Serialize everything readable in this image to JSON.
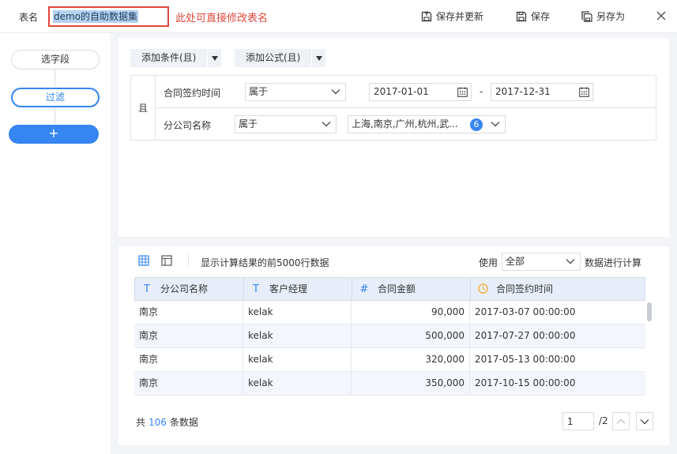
{
  "header": {
    "table_name_label": "表名",
    "table_name_value": "demo的自助数据集",
    "rename_hint": "此处可直接修改表名",
    "save_update_label": "保存并更新",
    "save_label": "保存",
    "save_as_label": "另存为"
  },
  "sidebar": {
    "steps": [
      {
        "label": "选字段"
      },
      {
        "label": "过滤"
      }
    ],
    "add_label": "+"
  },
  "filter": {
    "add_condition_label": "添加条件(且)",
    "add_formula_label": "添加公式(且)",
    "logic_label": "且",
    "rows": [
      {
        "field": "合同签约时间",
        "operator": "属于",
        "start_date": "2017-01-01",
        "separator": "-",
        "end_date": "2017-12-31"
      },
      {
        "field": "分公司名称",
        "operator": "属于",
        "values": "上海,南京,广州,杭州,武...",
        "count": "6"
      }
    ]
  },
  "result": {
    "hint": "显示计算结果的前5000行数据",
    "use_label": "使用",
    "use_value": "全部",
    "calc_label": "数据进行计算",
    "columns": [
      {
        "icon": "T",
        "label": "分公司名称"
      },
      {
        "icon": "T",
        "label": "客户经理"
      },
      {
        "icon": "#",
        "label": "合同金额"
      },
      {
        "icon": "clock",
        "label": "合同签约时间"
      }
    ],
    "rows": [
      [
        "南京",
        "kelak",
        "90,000",
        "2017-03-07 00:00:00"
      ],
      [
        "南京",
        "kelak",
        "500,000",
        "2017-07-27 00:00:00"
      ],
      [
        "南京",
        "kelak",
        "320,000",
        "2017-05-13 00:00:00"
      ],
      [
        "南京",
        "kelak",
        "350,000",
        "2017-10-15 00:00:00"
      ]
    ],
    "total_prefix": "共",
    "total_count": "106",
    "total_suffix": "条数据",
    "page_current": "1",
    "page_total": "/2"
  },
  "colors": {
    "accent": "#3685f2",
    "warning": "#e0463a",
    "clock": "#f5a623"
  }
}
